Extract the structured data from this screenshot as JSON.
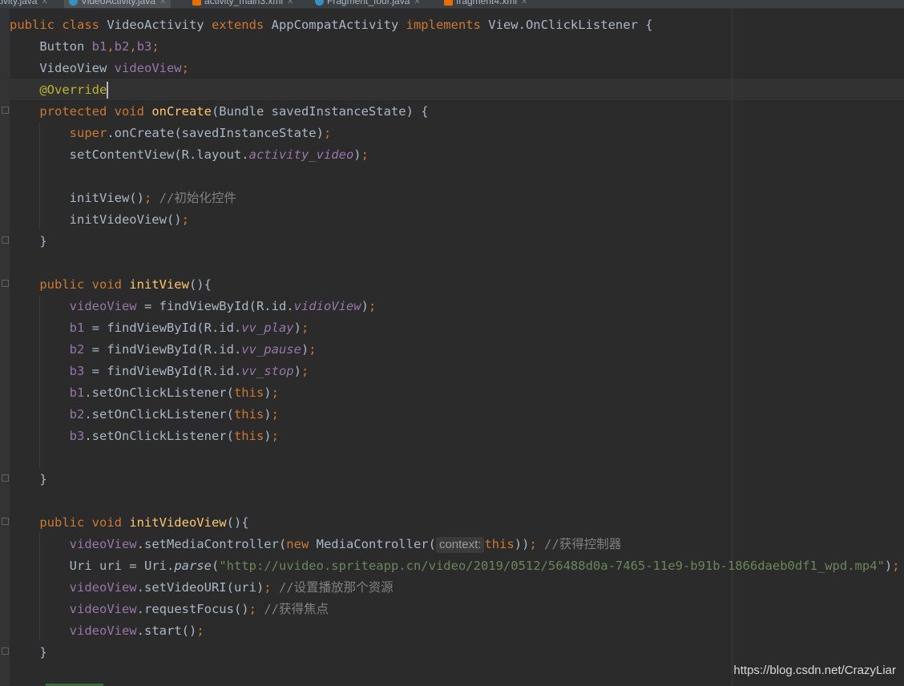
{
  "tabs": [
    {
      "name": "ctivity.java",
      "type": "java",
      "active": false
    },
    {
      "name": "VideoActivity.java",
      "type": "java",
      "active": true
    },
    {
      "name": "activity_main3.xml",
      "type": "xml",
      "active": false
    },
    {
      "name": "Fragment_four.java",
      "type": "java",
      "active": false
    },
    {
      "name": "fragment4.xml",
      "type": "xml",
      "active": false
    }
  ],
  "colors": {
    "background": "#2b2b2b",
    "keyword": "#cc7832",
    "method": "#ffc66d",
    "field": "#9876aa",
    "string": "#6a8759",
    "comment": "#808080",
    "annotation": "#bbb529",
    "text": "#a9b7c6"
  },
  "code": {
    "l1": {
      "a": "public class ",
      "b": "VideoActivity ",
      "c": "extends ",
      "d": "AppCompatActivity ",
      "e": "implements ",
      "f": "View.OnClickListener {"
    },
    "l2": {
      "a": "    Button ",
      "b": "b1",
      "c": ",",
      "d": "b2",
      "e": ",",
      "f": "b3",
      "g": ";"
    },
    "l3": {
      "a": "    VideoView ",
      "b": "videoView",
      "c": ";"
    },
    "l4": {
      "a": "    @Override"
    },
    "l5": {
      "a": "    protected void ",
      "b": "onCreate",
      "c": "(Bundle savedInstanceState) {"
    },
    "l6": {
      "a": "        super",
      "b": ".onCreate(savedInstanceState)",
      "c": ";"
    },
    "l7": {
      "a": "        setContentView(R.layout.",
      "b": "activity_video",
      "c": ")",
      "d": ";"
    },
    "l9": {
      "a": "        initView()",
      "b": "; ",
      "c": "//初始化控件"
    },
    "l10": {
      "a": "        initVideoView()",
      "b": ";"
    },
    "l11": {
      "a": "    }"
    },
    "l13": {
      "a": "    public void ",
      "b": "initView",
      "c": "(){"
    },
    "l14": {
      "a": "        ",
      "b": "videoView ",
      "c": "= findViewById(R.id.",
      "d": "vidioView",
      "e": ")",
      "f": ";"
    },
    "l15": {
      "a": "        ",
      "b": "b1 ",
      "c": "= findViewById(R.id.",
      "d": "vv_play",
      "e": ")",
      "f": ";"
    },
    "l16": {
      "a": "        ",
      "b": "b2 ",
      "c": "= findViewById(R.id.",
      "d": "vv_pause",
      "e": ")",
      "f": ";"
    },
    "l17": {
      "a": "        ",
      "b": "b3 ",
      "c": "= findViewById(R.id.",
      "d": "vv_stop",
      "e": ")",
      "f": ";"
    },
    "l18": {
      "a": "        ",
      "b": "b1",
      "c": ".setOnClickListener(",
      "d": "this",
      "e": ")",
      "f": ";"
    },
    "l19": {
      "a": "        ",
      "b": "b2",
      "c": ".setOnClickListener(",
      "d": "this",
      "e": ")",
      "f": ";"
    },
    "l20": {
      "a": "        ",
      "b": "b3",
      "c": ".setOnClickListener(",
      "d": "this",
      "e": ")",
      "f": ";"
    },
    "l22": {
      "a": "    }"
    },
    "l24": {
      "a": "    public void ",
      "b": "initVideoView",
      "c": "(){"
    },
    "l25": {
      "a": "        ",
      "b": "videoView",
      "c": ".setMediaController(",
      "d": "new ",
      "e": "MediaController(",
      "hint": "context:",
      "f": "this",
      "g": "))",
      "h": "; ",
      "i": "//获得控制器"
    },
    "l26": {
      "a": "        Uri uri = Uri.",
      "b": "parse",
      "c": "(",
      "d": "\"http://uvideo.spriteapp.cn/video/2019/0512/56488d0a-7465-11e9-b91b-1866daeb0df1_wpd.mp4\"",
      "e": ")",
      "f": ";"
    },
    "l27": {
      "a": "        ",
      "b": "videoView",
      "c": ".setVideoURI(uri)",
      "d": "; ",
      "e": "//设置播放那个资源"
    },
    "l28": {
      "a": "        ",
      "b": "videoView",
      "c": ".requestFocus()",
      "d": "; ",
      "e": "//获得焦点"
    },
    "l29": {
      "a": "        ",
      "b": "videoView",
      "c": ".start()",
      "d": ";"
    },
    "l30": {
      "a": "    }"
    }
  },
  "watermark": "https://blog.csdn.net/CrazyLiar"
}
